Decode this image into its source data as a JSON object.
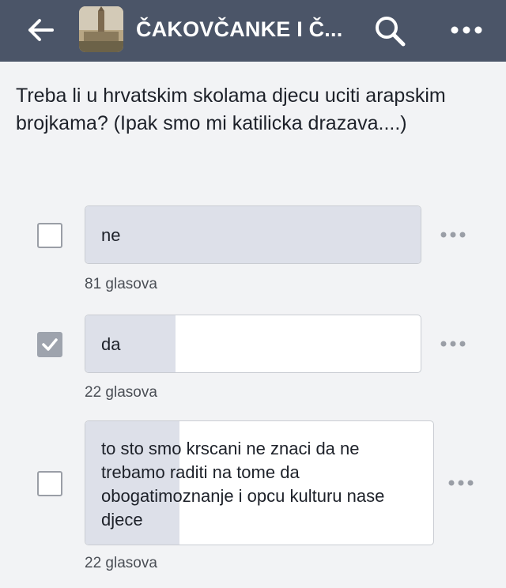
{
  "header": {
    "title": "ČAKOVČANKE I Č...",
    "back_icon": "back-arrow-icon",
    "search_icon": "search-icon",
    "more_icon": "more-dots-icon",
    "bar_color": "#4b5568"
  },
  "poll": {
    "question": "Treba li u hrvatskim skolama djecu uciti arapskim brojkama? (Ipak smo mi katilicka drazava....)",
    "options": [
      {
        "label": "ne",
        "votes": "81 glasova",
        "checked": false,
        "fill_fraction": 1.0
      },
      {
        "label": "da",
        "votes": "22 glasova",
        "checked": true,
        "fill_fraction": 0.27
      },
      {
        "label": "to sto smo krscani ne znaci da ne trebamo raditi na tome da obogatimoznanje i opcu kulturu nase djece",
        "votes": "22 glasova",
        "checked": false,
        "fill_fraction": 0.27
      }
    ]
  },
  "colors": {
    "fill": "#dde0e9",
    "checkbox_checked": "#9ea3ad"
  }
}
